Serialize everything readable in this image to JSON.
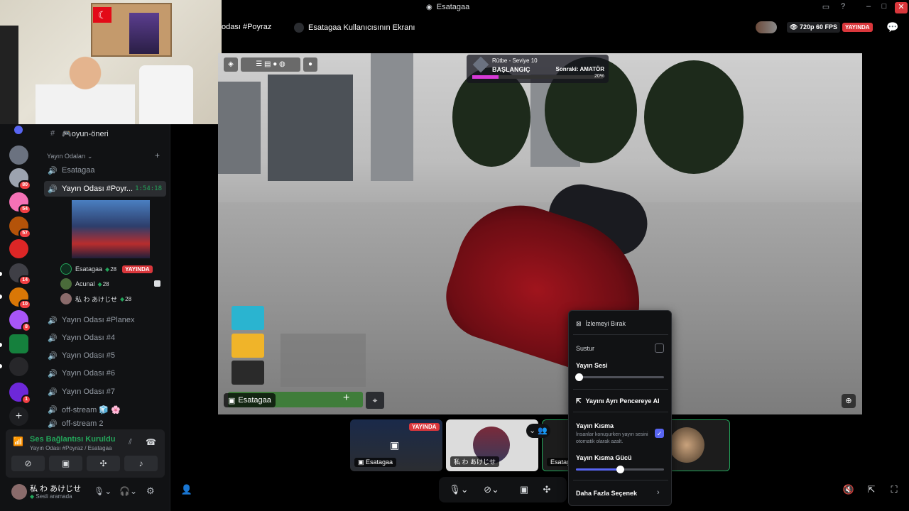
{
  "window": {
    "title": "Esatagaa",
    "app_icon": "discord-icon"
  },
  "header": {
    "tab_a": "odası #Poyraz",
    "tab_b": "Esatagaa Kullanıcısının Ekranı",
    "quality": "720p 60 FPS",
    "live": "YAYINDA"
  },
  "channels": {
    "top_channel": "🎮oyun-öneri",
    "category": "Yayın Odaları",
    "items": [
      {
        "label": "Esatagaa"
      },
      {
        "label": "Yayın Odası #Poyr...",
        "timer": "1:54:18"
      },
      {
        "label": "Yayın Odası #Planex"
      },
      {
        "label": "Yayın Odası #4"
      },
      {
        "label": "Yayın Odası #5"
      },
      {
        "label": "Yayın Odası #6"
      },
      {
        "label": "Yayın Odası #7"
      },
      {
        "label": "off-stream 🧊 🌸"
      },
      {
        "label": "off-stream 2"
      }
    ],
    "voice_users": [
      {
        "name": "Esatagaa",
        "level": "28",
        "badge": "YAYINDA"
      },
      {
        "name": "Acunal",
        "level": "28"
      },
      {
        "name": "私 わ あけじせ",
        "level": "28"
      }
    ]
  },
  "servers": {
    "badges": [
      "80",
      "54",
      "57",
      "14",
      "10",
      "8",
      "1"
    ]
  },
  "voice_panel": {
    "status": "Ses Bağlantısı Kuruldu",
    "sub": "Yayın Odası #Poyraz / Esatagaa"
  },
  "user_bar": {
    "name": "私 わ あけじせ",
    "status": "Sesli aramada"
  },
  "game": {
    "rank_title": "Rütbe - Seviye 10",
    "rank_name": "BAŞLANGIÇ",
    "next": "Sonraki: AMATÖR",
    "progress_pct": "20%",
    "progress": 0.2,
    "stream_label": "Esatagaa"
  },
  "menu": {
    "stop_watching": "İzlemeyi Bırak",
    "mute": "Sustur",
    "volume_label": "Yayın Sesi",
    "volume": 0.03,
    "popout": "Yayını Ayrı Pencereye Al",
    "attenuation": "Yayın Kısma",
    "attenuation_desc": "İnsanlar konuşurken yayın sesini otomatik olarak azalt.",
    "attenuation_strength_label": "Yayın Kısma Gücü",
    "attenuation_strength": 0.5,
    "more": "Daha Fazla Seçenek"
  },
  "thumbnails": [
    {
      "label": "Esatagaa",
      "live": "YAYINDA"
    },
    {
      "label": "私 わ あけじせ"
    },
    {
      "label": "Esatag"
    }
  ],
  "colors": {
    "accent": "#5865f2",
    "live": "#da373c",
    "green": "#23a55a"
  }
}
